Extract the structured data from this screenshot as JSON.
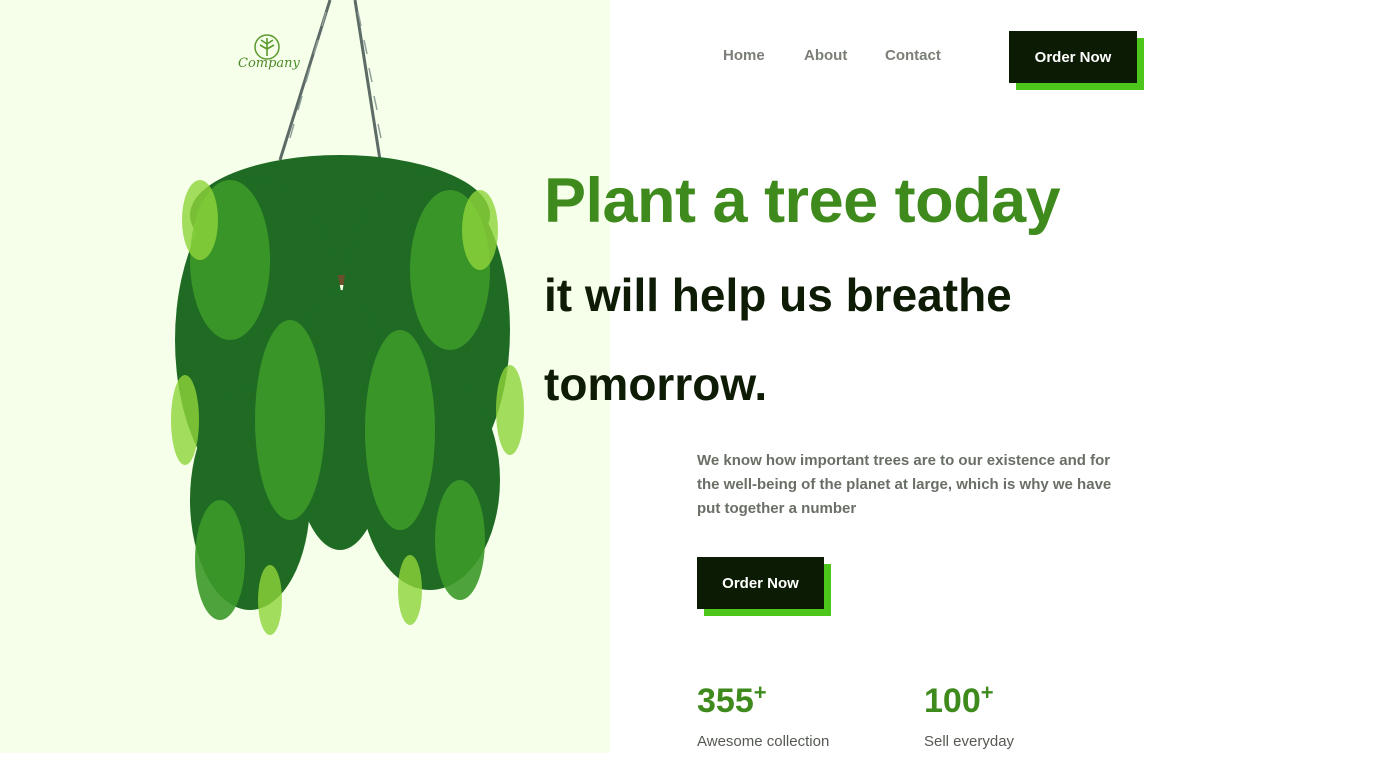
{
  "logo": {
    "text": "Company",
    "icon": "leaf-logo-icon"
  },
  "nav": {
    "items": [
      "Home",
      "About",
      "Contact"
    ],
    "cta": "Order Now"
  },
  "hero": {
    "title": "Plant a tree today",
    "subtitle_line1": "it will help us breathe",
    "subtitle_line2": "tomorrow.",
    "description": "We know how important trees are to our existence and for the well-being of the planet at large, which is why we have put together a number",
    "cta": "Order Now"
  },
  "stats": [
    {
      "value": "355",
      "suffix": "+",
      "label": "Awesome collection"
    },
    {
      "value": "100",
      "suffix": "+",
      "label": "Sell everyday"
    }
  ],
  "colors": {
    "accent": "#3e8a1c",
    "dark": "#0c1c04",
    "shadow": "#4cc61a",
    "panel": "#f6ffea"
  }
}
